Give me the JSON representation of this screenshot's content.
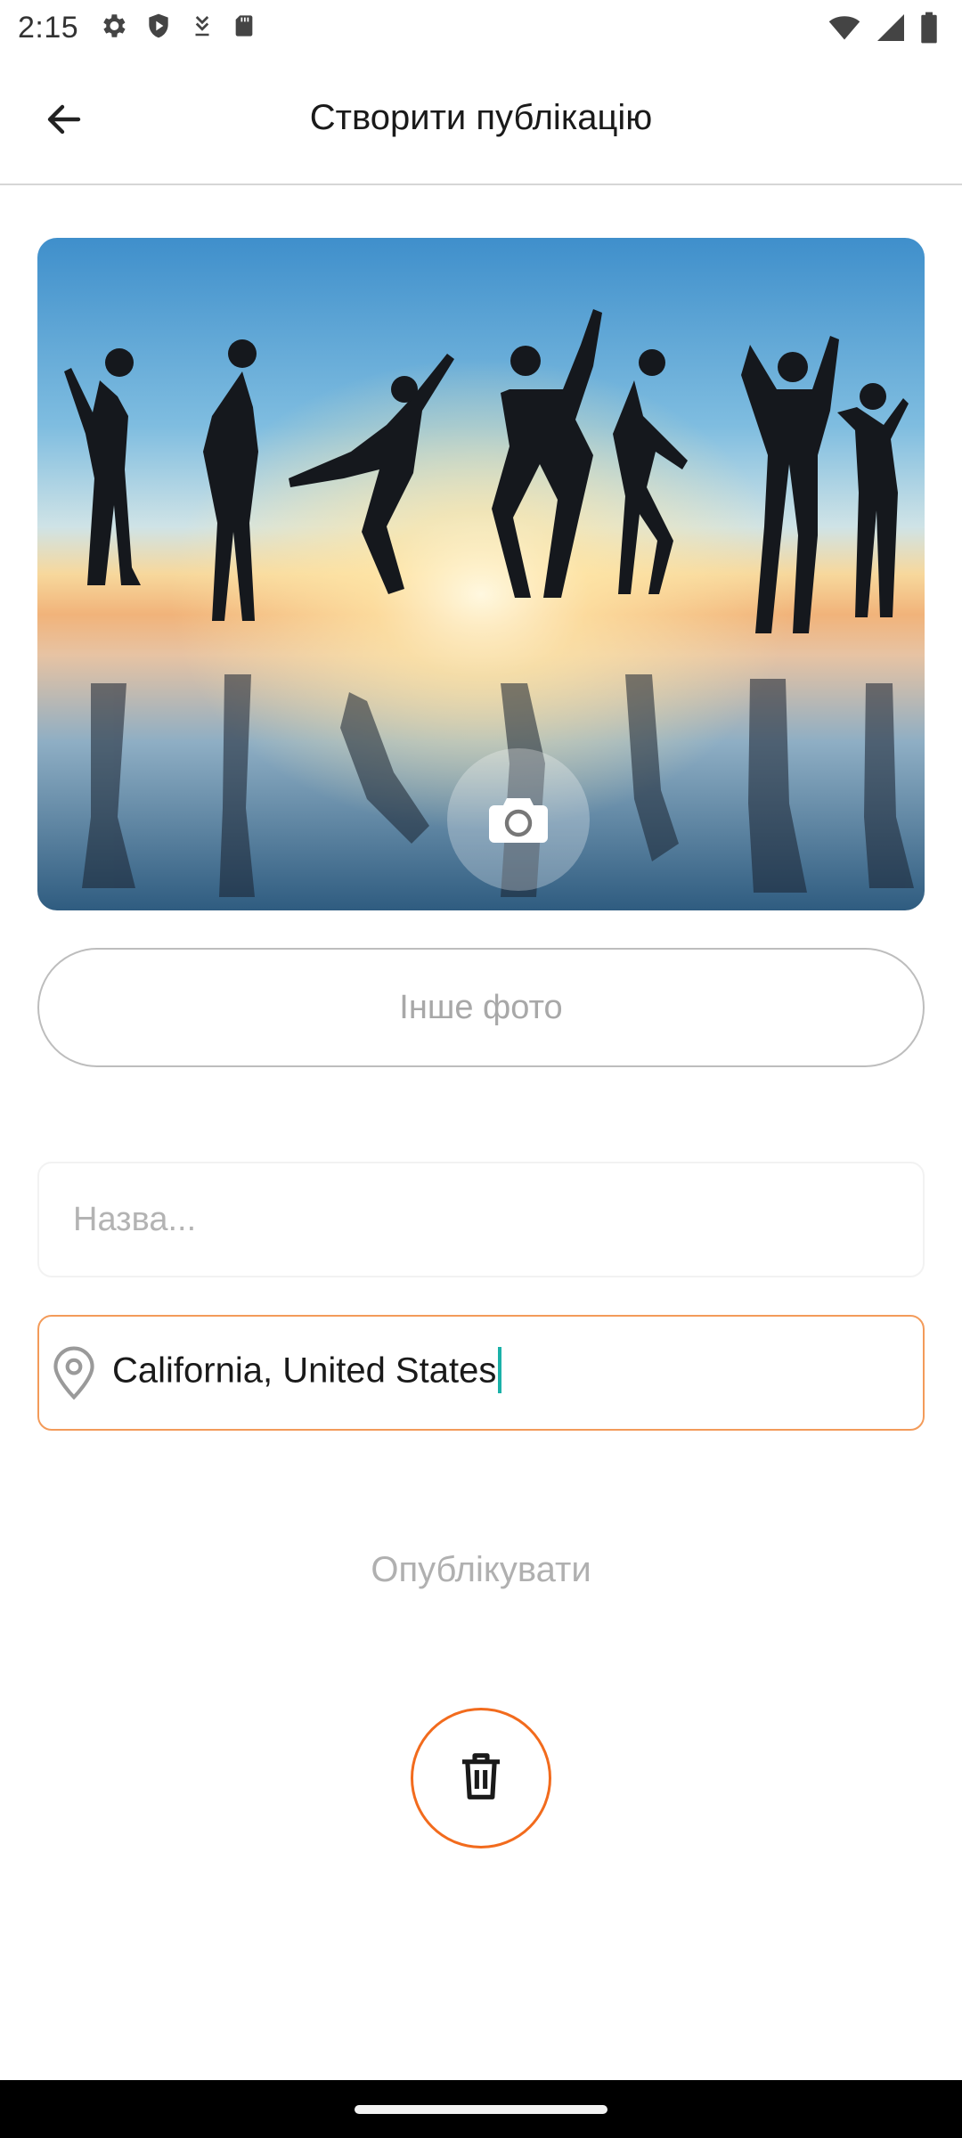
{
  "status_bar": {
    "time": "2:15",
    "left_icons": [
      "gear-icon",
      "shield-icon",
      "download-icon",
      "sd-card-icon"
    ],
    "right_icons": [
      "wifi-icon",
      "signal-icon",
      "battery-icon"
    ]
  },
  "app_bar": {
    "title": "Створити публікацію",
    "back_icon": "arrow-back-icon"
  },
  "photo": {
    "overlay_icon": "camera-icon"
  },
  "actions": {
    "other_photo_label": "Інше фото",
    "publish_label": "Опублікувати",
    "delete_icon": "trash-icon"
  },
  "form": {
    "title_placeholder": "Назва...",
    "title_value": "",
    "location_icon": "location-pin-icon",
    "location_value": "California, United States"
  },
  "colors": {
    "accent": "#f26b1d",
    "field_focus_border": "#f39b5a",
    "cursor": "#1bb1a8",
    "muted_text": "#b0b0b0"
  }
}
